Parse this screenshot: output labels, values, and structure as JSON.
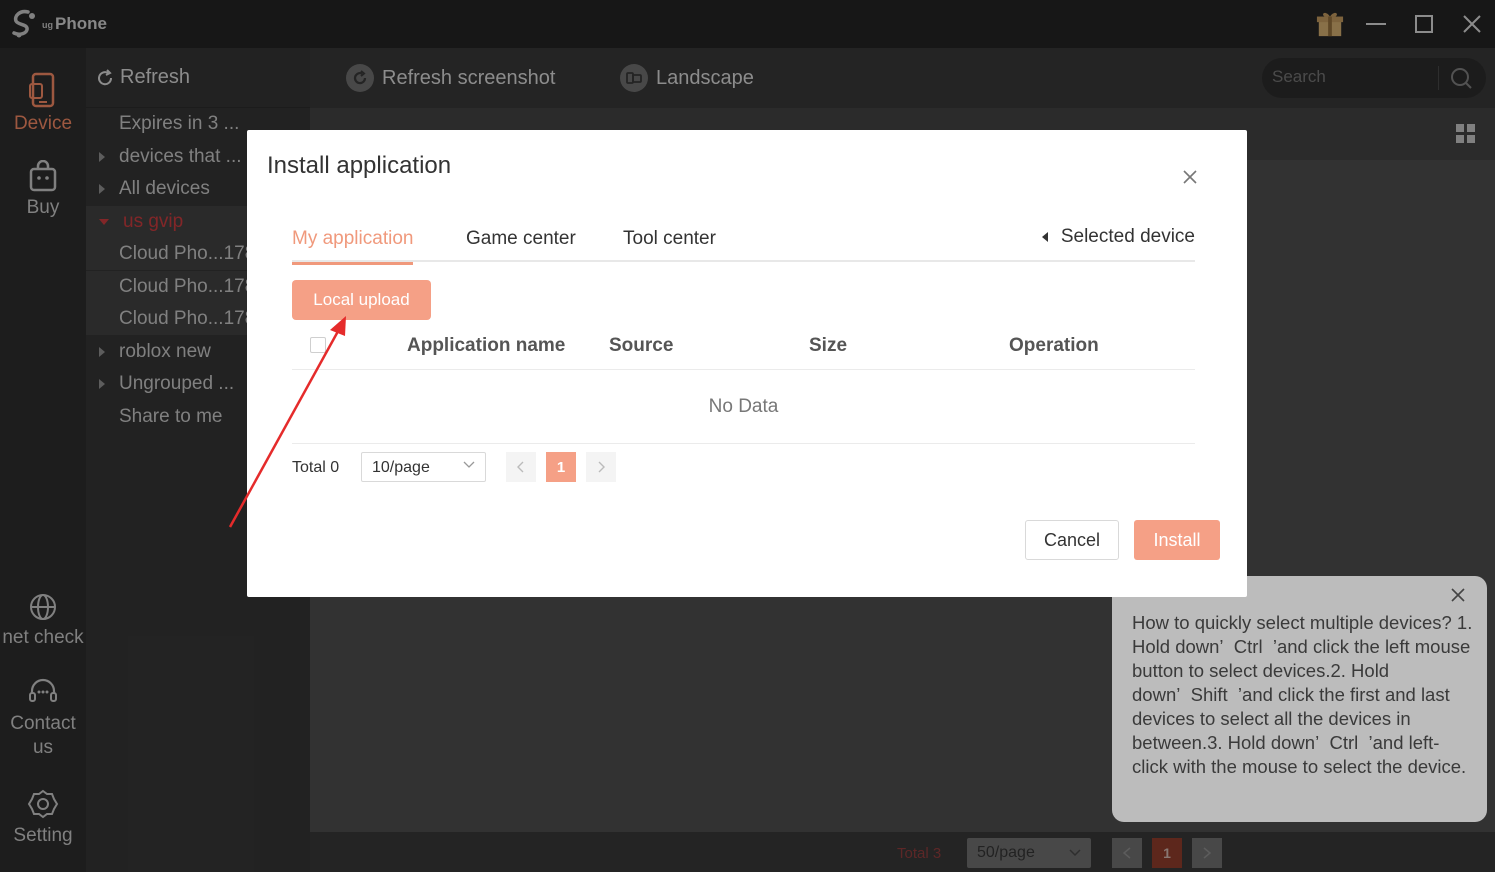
{
  "app": {
    "title": "Phone",
    "brand_prefix": "ug"
  },
  "leftnav": {
    "device": "Device",
    "buy": "Buy",
    "net_check": "net check",
    "contact": "Contact us",
    "setting": "Setting"
  },
  "groups": {
    "refresh": "Refresh",
    "items": [
      {
        "label": "Expires in 3 ..."
      },
      {
        "label": "devices that ..."
      },
      {
        "label": "All devices"
      },
      {
        "label": "us gvip"
      },
      {
        "label": "Cloud Pho...178"
      },
      {
        "label": "Cloud Pho...178"
      },
      {
        "label": "Cloud Pho...178"
      },
      {
        "label": "roblox new"
      },
      {
        "label": "Ungrouped ..."
      },
      {
        "label": "Share to me"
      }
    ]
  },
  "toolbar": {
    "refresh_screenshot": "Refresh screenshot",
    "landscape": "Landscape",
    "search_placeholder": "Search"
  },
  "bottombar": {
    "total": "Total 3",
    "page_size": "50/page",
    "current_page": "1"
  },
  "dialog": {
    "title": "Install application",
    "tabs": [
      "My application",
      "Game center",
      "Tool center"
    ],
    "selected_device": "Selected device",
    "local_upload": "Local upload",
    "columns": [
      "Application name",
      "Source",
      "Size",
      "Operation"
    ],
    "no_data": "No Data",
    "total": "Total 0",
    "page_size": "10/page",
    "current_page": "1",
    "cancel": "Cancel",
    "install": "Install"
  },
  "tooltip": {
    "text": "How to quickly select multiple devices? 1. Hold down’  Ctrl  ’and click the left mouse button to select devices.2. Hold down’  Shift  ’and click the first and last devices to select all the devices in between.3. Hold down’  Ctrl  ’and left-click with the mouse to select the device."
  },
  "colors": {
    "accent": "#f5a086",
    "accent_text": "#f0997c",
    "highlight_red": "#c0393b"
  }
}
